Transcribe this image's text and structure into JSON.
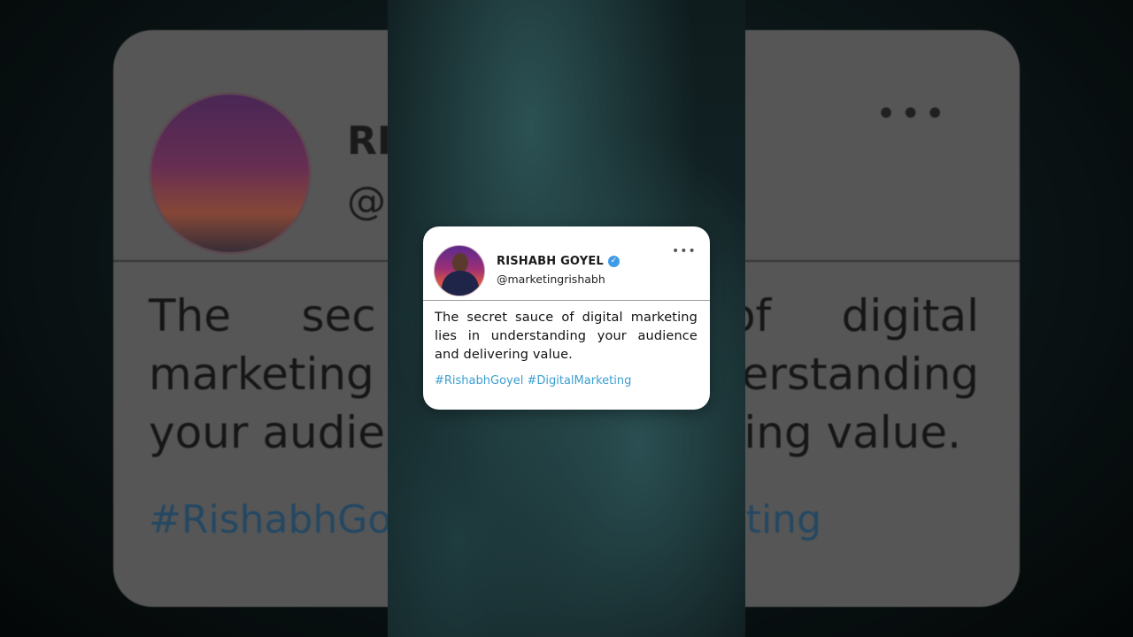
{
  "tweet": {
    "author_name": "RISHABH GOYEL",
    "handle": "@marketingrishabh",
    "verified_icon": "verified-check-icon",
    "more_icon": "more-horizontal-icon",
    "more_label": "•••",
    "text": "The secret sauce of digital marketing lies in understanding your audience and delivering value.",
    "hashtags": [
      "#RishabhGoyel",
      "#DigitalMarketing"
    ]
  },
  "background_copy": {
    "name_fragment": "RIS",
    "handle_fragment": "@",
    "line1_left": "The     sec",
    "line1_right": "of     digital",
    "line2_left": "marketing",
    "line2_right": "erstanding",
    "line3_left": "your audie",
    "line3_right": "ing value.",
    "tags_left": "#RishabhGo",
    "tags_right": "ting"
  },
  "colors": {
    "hashtag": "#3a9ed2",
    "verified": "#3d9be9",
    "background": "#0b1214"
  }
}
